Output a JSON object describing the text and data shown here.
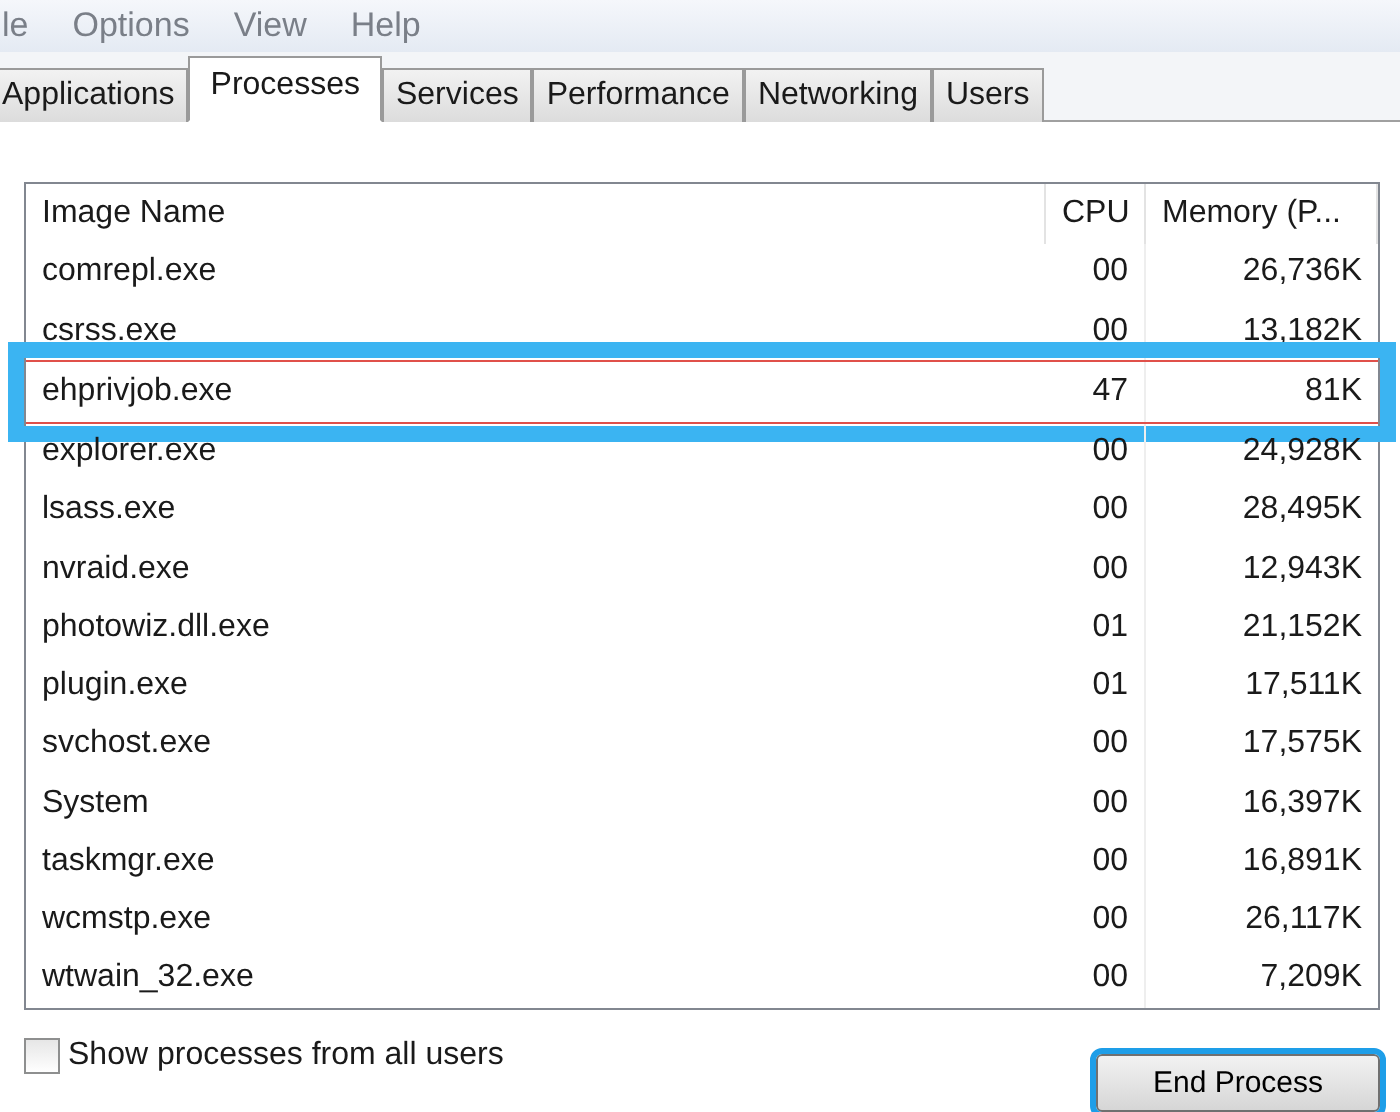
{
  "menu": [
    "le",
    "Options",
    "View",
    "Help"
  ],
  "tabs": [
    {
      "label": "Applications",
      "selected": false
    },
    {
      "label": "Processes",
      "selected": true
    },
    {
      "label": "Services",
      "selected": false
    },
    {
      "label": "Performance",
      "selected": false
    },
    {
      "label": "Networking",
      "selected": false
    },
    {
      "label": "Users",
      "selected": false
    }
  ],
  "table": {
    "columns": [
      "Image Name",
      "CPU",
      "Memory (P..."
    ],
    "rows": [
      {
        "name": "comrepl.exe",
        "cpu": "00",
        "memory": "26,736K",
        "selected": false
      },
      {
        "name": "csrss.exe",
        "cpu": "00",
        "memory": "13,182K",
        "selected": false
      },
      {
        "name": "ehprivjob.exe",
        "cpu": "47",
        "memory": "81K",
        "selected": true
      },
      {
        "name": "explorer.exe",
        "cpu": "00",
        "memory": "24,928K",
        "selected": false
      },
      {
        "name": "lsass.exe",
        "cpu": "00",
        "memory": "28,495K",
        "selected": false
      },
      {
        "name": "nvraid.exe",
        "cpu": "00",
        "memory": "12,943K",
        "selected": false
      },
      {
        "name": "photowiz.dll.exe",
        "cpu": "01",
        "memory": "21,152K",
        "selected": false
      },
      {
        "name": "plugin.exe",
        "cpu": "01",
        "memory": "17,511K",
        "selected": false
      },
      {
        "name": "svchost.exe",
        "cpu": "00",
        "memory": "17,575K",
        "selected": false
      },
      {
        "name": "System",
        "cpu": "00",
        "memory": "16,397K",
        "selected": false
      },
      {
        "name": "taskmgr.exe",
        "cpu": "00",
        "memory": "16,891K",
        "selected": false
      },
      {
        "name": "wcmstp.exe",
        "cpu": "00",
        "memory": "26,117K",
        "selected": false
      },
      {
        "name": "wtwain_32.exe",
        "cpu": "00",
        "memory": "7,209K",
        "selected": false
      }
    ]
  },
  "show_all_users": {
    "label": "Show processes from all users",
    "checked": false
  },
  "end_button": {
    "label": "End Process",
    "focused": true
  }
}
